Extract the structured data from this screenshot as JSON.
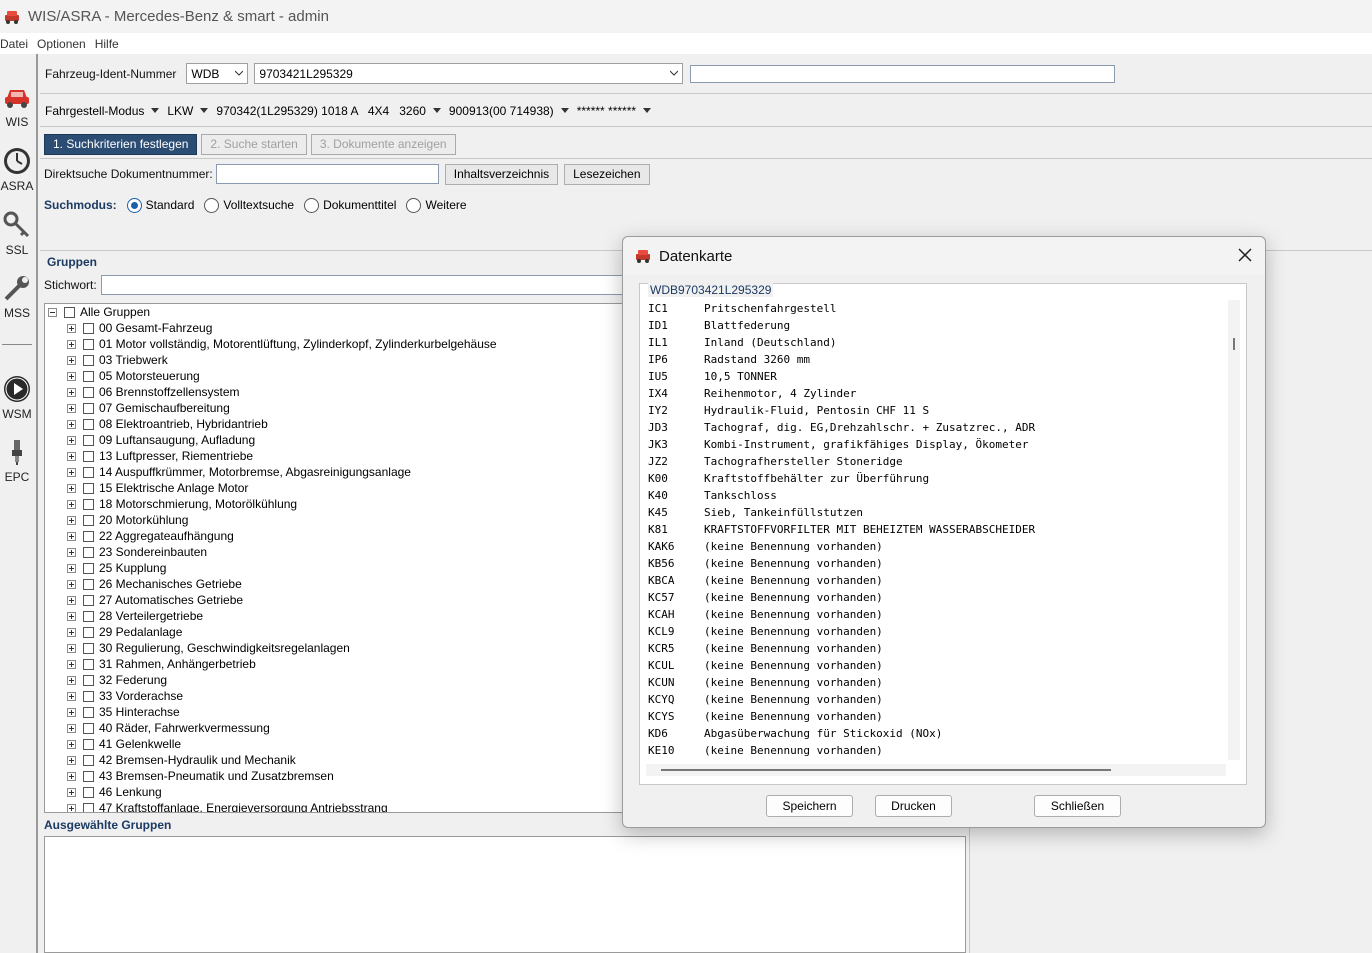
{
  "window": {
    "title": "WIS/ASRA - Mercedes-Benz & smart - admin"
  },
  "menu": [
    "Datei",
    "Optionen",
    "Hilfe"
  ],
  "sidebar": [
    {
      "label": "WIS",
      "icon": "car-icon"
    },
    {
      "label": "ASRA",
      "icon": "clock-icon"
    },
    {
      "label": "SSL",
      "icon": "key-icon"
    },
    {
      "label": "MSS",
      "icon": "wrench-icon"
    },
    {
      "label": "WSM",
      "icon": "play-icon"
    },
    {
      "label": "EPC",
      "icon": "spark-plug-icon"
    }
  ],
  "fin": {
    "label": "Fahrzeug-Ident-Nummer",
    "prefix": "WDB",
    "number": "9703421L295329",
    "extra": ""
  },
  "mode_bar": [
    "Fahrgestell-Modus",
    "LKW",
    "970342(1L295329) 1018 A   4X4   3260",
    "900913(00 714938)",
    "****** ******"
  ],
  "steps": {
    "step1": "1. Suchkriterien festlegen",
    "step2": "2. Suche starten",
    "step3": "3. Dokumente anzeigen"
  },
  "direct_search": {
    "label": "Direktsuche Dokumentnummer:",
    "value": "",
    "toc_button": "Inhaltsverzeichnis",
    "bookmark_button": "Lesezeichen"
  },
  "search_mode": {
    "label": "Suchmodus:",
    "options": [
      "Standard",
      "Volltextsuche",
      "Dokumenttitel",
      "Weitere"
    ],
    "selected": "Standard"
  },
  "groups": {
    "header": "Gruppen",
    "keyword_label": "Stichwort:",
    "keyword_value": "",
    "root": "Alle Gruppen",
    "items": [
      "00  Gesamt-Fahrzeug",
      "01  Motor vollständig, Motorentlüftung, Zylinderkopf, Zylinderkurbelgehäuse",
      "03  Triebwerk",
      "05  Motorsteuerung",
      "06  Brennstoffzellensystem",
      "07  Gemischaufbereitung",
      "08  Elektroantrieb, Hybridantrieb",
      "09  Luftansaugung, Aufladung",
      "13  Luftpresser, Riementriebe",
      "14  Auspuffkrümmer, Motorbremse, Abgasreinigungsanlage",
      "15  Elektrische Anlage Motor",
      "18  Motorschmierung, Motorölkühlung",
      "20  Motorkühlung",
      "22  Aggregateaufhängung",
      "23  Sondereinbauten",
      "25  Kupplung",
      "26  Mechanisches Getriebe",
      "27  Automatisches Getriebe",
      "28  Verteilergetriebe",
      "29  Pedalanlage",
      "30  Regulierung, Geschwindigkeitsregelanlagen",
      "31  Rahmen, Anhängerbetrieb",
      "32  Federung",
      "33  Vorderachse",
      "35  Hinterachse",
      "40  Räder, Fahrwerkvermessung",
      "41  Gelenkwelle",
      "42  Bremsen-Hydraulik und Mechanik",
      "43  Bremsen-Pneumatik und Zusatzbremsen",
      "46  Lenkung",
      "47  Kraftstoffanlage, Energieversorgung Antriebsstrang"
    ]
  },
  "selected_groups": {
    "header": "Ausgewählte Gruppen"
  },
  "dialog": {
    "title": "Datenkarte",
    "legend": "WDB9703421L295329",
    "rows": [
      [
        "IC1",
        "Pritschenfahrgestell"
      ],
      [
        "ID1",
        "Blattfederung"
      ],
      [
        "IL1",
        "Inland (Deutschland)"
      ],
      [
        "IP6",
        "Radstand 3260 mm"
      ],
      [
        "IU5",
        "10,5 TONNER"
      ],
      [
        "IX4",
        "Reihenmotor, 4 Zylinder"
      ],
      [
        "IY2",
        "Hydraulik-Fluid, Pentosin CHF 11 S"
      ],
      [
        "JD3",
        "Tachograf, dig. EG,Drehzahlschr. + Zusatzrec., ADR"
      ],
      [
        "JK3",
        "Kombi-Instrument, grafikfähiges Display, Ökometer"
      ],
      [
        "JZ2",
        "Tachografhersteller Stoneridge"
      ],
      [
        "K00",
        "Kraftstoffbehälter zur Überführung"
      ],
      [
        "K40",
        "Tankschloss"
      ],
      [
        "K45",
        "Sieb, Tankeinfüllstutzen"
      ],
      [
        "K81",
        "KRAFTSTOFFVORFILTER MIT BEHEIZTEM WASSERABSCHEIDER"
      ],
      [
        "KAK6",
        "(keine Benennung vorhanden)"
      ],
      [
        "KB56",
        "(keine Benennung vorhanden)"
      ],
      [
        "KBCA",
        "(keine Benennung vorhanden)"
      ],
      [
        "KC57",
        "(keine Benennung vorhanden)"
      ],
      [
        "KCAH",
        "(keine Benennung vorhanden)"
      ],
      [
        "KCL9",
        "(keine Benennung vorhanden)"
      ],
      [
        "KCR5",
        "(keine Benennung vorhanden)"
      ],
      [
        "KCUL",
        "(keine Benennung vorhanden)"
      ],
      [
        "KCUN",
        "(keine Benennung vorhanden)"
      ],
      [
        "KCYQ",
        "(keine Benennung vorhanden)"
      ],
      [
        "KCYS",
        "(keine Benennung vorhanden)"
      ],
      [
        "KD6",
        "Abgasüberwachung für Stickoxid (NOx)"
      ],
      [
        "KE10",
        "(keine Benennung vorhanden)"
      ]
    ],
    "save_button": "Speichern",
    "print_button": "Drucken",
    "close_button": "Schließen"
  }
}
